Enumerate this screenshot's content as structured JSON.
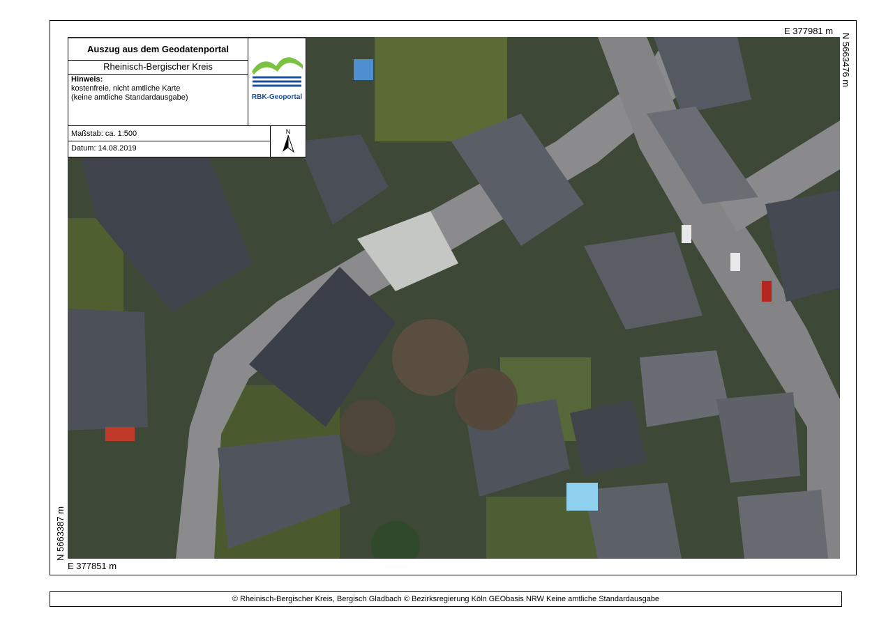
{
  "legend": {
    "title": "Auszug aus dem Geodatenportal",
    "subtitle": "Rheinisch-Bergischer Kreis",
    "hint_heading": "Hinweis:",
    "hint_line1": "kostenfreie, nicht amtliche Karte",
    "hint_line2": "(keine amtliche Standardausgabe)",
    "logo_text": "RBK-Geoportal",
    "scale": "Maßstab: ca. 1:500",
    "date": "Datum:   14.08.2019",
    "north_label": "N"
  },
  "coordinates": {
    "east_top": "E 377981 m",
    "north_right": "N 5663476 m",
    "north_left": "N 5663387 m",
    "east_bottom": "E 377851 m"
  },
  "footer": {
    "text": "© Rheinisch-Bergischer Kreis, Bergisch Gladbach   © Bezirksregierung Köln GEObasis NRW  Keine amtliche Standardausgabe"
  },
  "colors": {
    "logo_green": "#7cc242",
    "logo_blue": "#1a4f9c",
    "roof": "#4a4f58",
    "road": "#8a8a8c",
    "vegetation": "#4b5e32"
  }
}
